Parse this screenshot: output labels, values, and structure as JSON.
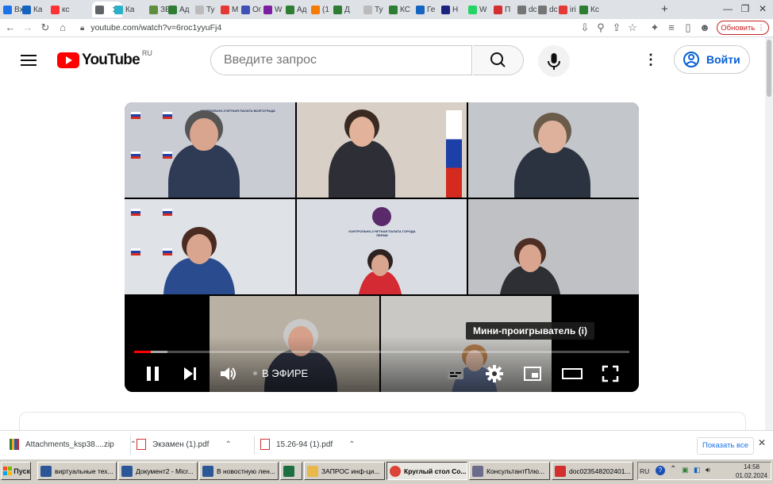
{
  "browser": {
    "tabs": [
      {
        "title": "Вх",
        "color": "#1a73e8"
      },
      {
        "title": "Ка",
        "color": "#1565c0"
      },
      {
        "title": "кс",
        "color": "#ff3333"
      },
      {
        "title": "",
        "color": "#5f6368",
        "active": true
      },
      {
        "title": "Ка",
        "color": "#2bb0c8"
      },
      {
        "title": "ЗЕ",
        "color": "#5e8e3e"
      },
      {
        "title": "Ад",
        "color": "#2e7d32"
      },
      {
        "title": "Ту",
        "color": "#bbbbbb"
      },
      {
        "title": "М",
        "color": "#e53935"
      },
      {
        "title": "Ог",
        "color": "#3f51b5"
      },
      {
        "title": "W",
        "color": "#7b1fa2"
      },
      {
        "title": "Ад",
        "color": "#2e7d32"
      },
      {
        "title": "(1",
        "color": "#f57c00"
      },
      {
        "title": "Д",
        "color": "#2e7d32"
      },
      {
        "title": "Ту",
        "color": "#bbbbbb"
      },
      {
        "title": "КС",
        "color": "#2e7d32"
      },
      {
        "title": "Ге",
        "color": "#1565c0"
      },
      {
        "title": "Н",
        "color": "#1a237e"
      },
      {
        "title": "W",
        "color": "#25d366"
      },
      {
        "title": "П",
        "color": "#d32f2f"
      },
      {
        "title": "dc",
        "color": "#757575"
      },
      {
        "title": "dc",
        "color": "#757575"
      },
      {
        "title": "iri",
        "color": "#e53935"
      },
      {
        "title": "Кс",
        "color": "#2e7d32"
      }
    ],
    "new_tab_label": "+",
    "url": "youtube.com/watch?v=6roc1yyuFj4",
    "update_label": "Обновить"
  },
  "youtube": {
    "logo_text": "YouTube",
    "country_code": "RU",
    "search_placeholder": "Введите запрос",
    "sign_in_label": "Войти"
  },
  "player": {
    "live_label": "В ЭФИРЕ",
    "tooltip": "Мини-проигрыватель (i)",
    "progress_played": 0.034,
    "progress_loaded": 0.068
  },
  "conference_tiles": [
    {
      "label": "КОНТРОЛЬНО-СЧЕТНАЯ ПАЛАТА ВОЛГОГРАДА"
    },
    {
      "label": ""
    },
    {
      "label": ""
    },
    {
      "label": ""
    },
    {
      "label": "КОНТРОЛЬНО-СЧЕТНАЯ ПАЛАТА ГОРОДА ПЕРМИ"
    },
    {
      "label": ""
    },
    {
      "label": ""
    },
    {
      "label": ""
    }
  ],
  "downloads": [
    {
      "name": "Attachments_ksp38....zip",
      "type": "zip"
    },
    {
      "name": "Экзамен (1).pdf",
      "type": "pdf"
    },
    {
      "name": "15.26-94 (1).pdf",
      "type": "pdf"
    }
  ],
  "downloads_show_all": "Показать все",
  "taskbar": {
    "start_label": "Пуск",
    "tasks": [
      {
        "label": "виртуальные тех...",
        "icon": "word"
      },
      {
        "label": "Документ2 - Micr...",
        "icon": "word"
      },
      {
        "label": "В новостную лен...",
        "icon": "word"
      },
      {
        "label": "",
        "icon": "excel"
      },
      {
        "label": "ЗАПРОС инф-ци...",
        "icon": "folder"
      },
      {
        "label": "Круглый стол Со...",
        "icon": "chrome",
        "active": true
      },
      {
        "label": "КонсультантПлю...",
        "icon": "consultant"
      },
      {
        "label": "doc023548202401...",
        "icon": "pdf"
      }
    ],
    "language": "RU",
    "time": "14:58",
    "date": "01.02.2024"
  },
  "colors": {
    "youtube_red": "#ff0000",
    "link_blue": "#065fd4",
    "update_red": "#c5221f"
  }
}
